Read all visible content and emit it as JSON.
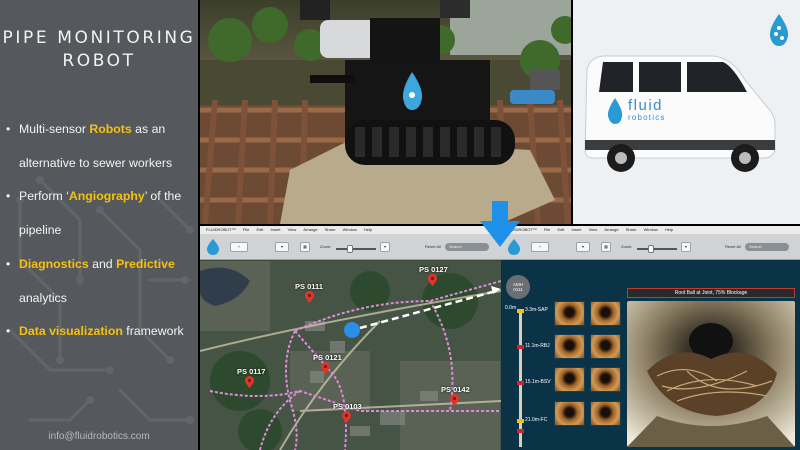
{
  "left_panel": {
    "title_line1": "PIPE MONITORING",
    "title_line2": "ROBOT",
    "bullets": [
      {
        "p1": "Multi-sensor ",
        "h1": "Robots",
        "p2": " as an alternative to sewer workers"
      },
      {
        "p1": "Perform ‘",
        "h1": "Angiography",
        "p2": "’ of the pipeline"
      },
      {
        "h1": "Diagnostics",
        "p1": " and ",
        "h2": "Predictive",
        "p2": " analytics"
      },
      {
        "h1": "Data visualization",
        "p2": " framework"
      }
    ],
    "email": "info@fluidrobotics.com"
  },
  "van": {
    "logo_word1": "fluid",
    "logo_word2": "robotics"
  },
  "app": {
    "menu_items": [
      "FLUIDROBOT™",
      "File",
      "Edit",
      "Insert",
      "View",
      "Arrange",
      "Share",
      "Window",
      "Help"
    ],
    "zoom_label": "Zoom:",
    "reset_all_label": "Reset All",
    "search_placeholder": "Search"
  },
  "map": {
    "pins": [
      {
        "label": "PS 0127"
      },
      {
        "label": "PS 0111"
      },
      {
        "label": "PS 0121"
      },
      {
        "label": "PS 0117"
      },
      {
        "label": "PS 0142"
      },
      {
        "label": "PS 0103"
      }
    ]
  },
  "analysis": {
    "manhole_label1": "AMH",
    "manhole_label2": "0111",
    "start_distance": "0.0m",
    "defects": [
      {
        "label": "3.3m-SAP"
      },
      {
        "label": "11.1m-RBJ"
      },
      {
        "label": "15.1m-BSV"
      },
      {
        "label": "21.0m-FC"
      }
    ],
    "banner": "Root Ball at Joint, 75% Blockage"
  },
  "colors": {
    "highlight": "#f5c20d",
    "panel_bg": "#55585c",
    "brand_blue": "#1e90d8",
    "pin_red": "#e0352b",
    "route_pink": "#e08ad8"
  }
}
